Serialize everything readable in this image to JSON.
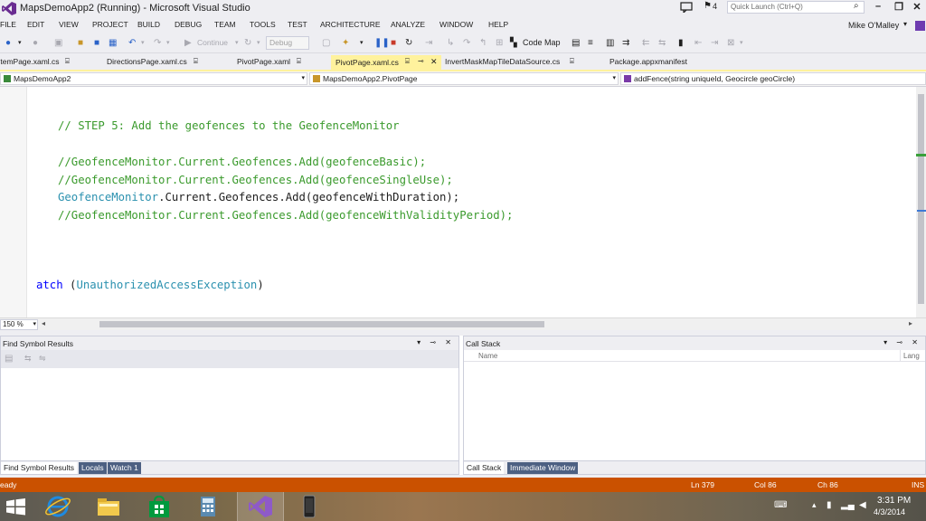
{
  "window": {
    "title": "MapsDemoApp2 (Running) - Microsoft Visual Studio",
    "notification_count": "4",
    "quick_launch_placeholder": "Quick Launch (Ctrl+Q)",
    "user": "Mike O'Malley"
  },
  "menu": [
    "FILE",
    "EDIT",
    "VIEW",
    "PROJECT",
    "BUILD",
    "DEBUG",
    "TEAM",
    "TOOLS",
    "TEST",
    "ARCHITECTURE",
    "ANALYZE",
    "WINDOW",
    "HELP"
  ],
  "toolbar": {
    "continue_label": "Continue",
    "config_value": "Debug",
    "code_map_label": "Code Map"
  },
  "tabs": [
    {
      "label": "ItemPage.xaml.cs"
    },
    {
      "label": "DirectionsPage.xaml.cs"
    },
    {
      "label": "PivotPage.xaml"
    },
    {
      "label": "PivotPage.xaml.cs",
      "active": true
    },
    {
      "label": "InvertMaskMapTileDataSource.cs"
    },
    {
      "label": "Package.appxmanifest"
    }
  ],
  "nav": {
    "project": "MapsDemoApp2",
    "type": "MapsDemoApp2.PivotPage",
    "member": "addFence(string uniqueId, Geocircle geoCircle)"
  },
  "code": {
    "line1": "// STEP 5: Add the geofences to the GeofenceMonitor",
    "line2": "//GeofenceMonitor.Current.Geofences.Add(geofenceBasic);",
    "line3": "//GeofenceMonitor.Current.Geofences.Add(geofenceSingleUse);",
    "line4_type": "GeofenceMonitor",
    "line4_rest": ".Current.Geofences.Add(geofenceWithDuration);",
    "line5": "//GeofenceMonitor.Current.Geofences.Add(geofenceWithValidityPeriod);",
    "line6_kw": "atch",
    "line6_open": " (",
    "line6_type": "UnauthorizedAccessException",
    "line6_close": ")"
  },
  "zoom": "150 %",
  "panels": {
    "left": {
      "title": "Find Symbol Results",
      "tabs": [
        "Find Symbol Results",
        "Locals",
        "Watch 1"
      ]
    },
    "right": {
      "title": "Call Stack",
      "columns": [
        "Name",
        "Lang"
      ],
      "tabs": [
        "Call Stack",
        "Immediate Window"
      ]
    }
  },
  "status": {
    "text": "eady",
    "ln": "Ln 379",
    "col": "Col 86",
    "ch": "Ch 86",
    "mode": "INS"
  },
  "taskbar": {
    "time": "3:31 PM",
    "date": "4/3/2014"
  },
  "colors": {
    "status_bar": "#ca5100",
    "active_tab": "#fff29d",
    "comment": "#3a9a2c",
    "type": "#2b91af",
    "keyword": "#0000ff"
  }
}
